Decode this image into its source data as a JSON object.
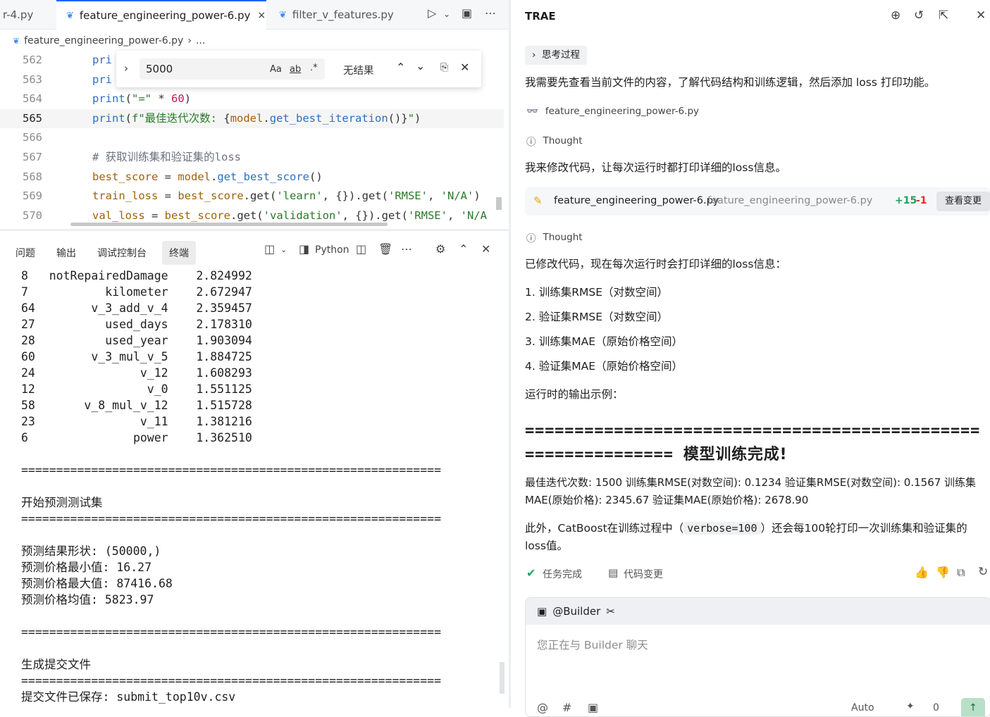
{
  "tabs": [
    {
      "label": "r-4.py"
    },
    {
      "label": "feature_engineering_power-6.py",
      "close": "×"
    },
    {
      "label": "filter_v_features.py"
    }
  ],
  "breadcrumb": {
    "file": "feature_engineering_power-6.py",
    "sep": "›",
    "more": "..."
  },
  "find": {
    "value": "5000",
    "case_label": "Aa",
    "word_label": "ab",
    "regex_label": ".*",
    "result": "无结果"
  },
  "code_lines": [
    {
      "n": "562",
      "parts": [
        [
          "kw",
          "pri"
        ]
      ]
    },
    {
      "n": "563",
      "parts": [
        [
          "kw",
          "pri"
        ]
      ]
    },
    {
      "n": "564",
      "parts": [
        [
          "kw",
          "print"
        ],
        [
          "op",
          "("
        ],
        [
          "str",
          "\"=\""
        ],
        [
          "op",
          " * "
        ],
        [
          "num",
          "60"
        ],
        [
          "op",
          ")"
        ]
      ]
    },
    {
      "n": "565",
      "parts": [
        [
          "kw",
          "print"
        ],
        [
          "op",
          "("
        ],
        [
          "str",
          "f\"最佳迭代次数: "
        ],
        [
          "op",
          "{"
        ],
        [
          "var",
          "model"
        ],
        [
          "op",
          "."
        ],
        [
          "kw",
          "get_best_iteration"
        ],
        [
          "op",
          "()}"
        ],
        [
          "str",
          "\""
        ],
        [
          "op",
          ")"
        ]
      ]
    },
    {
      "n": "566",
      "parts": []
    },
    {
      "n": "567",
      "parts": [
        [
          "cm",
          "# 获取训练集和验证集的loss"
        ]
      ]
    },
    {
      "n": "568",
      "parts": [
        [
          "var",
          "best_score"
        ],
        [
          "op",
          " = "
        ],
        [
          "var",
          "model"
        ],
        [
          "op",
          "."
        ],
        [
          "kw",
          "get_best_score"
        ],
        [
          "op",
          "()"
        ]
      ]
    },
    {
      "n": "569",
      "parts": [
        [
          "var",
          "train_loss"
        ],
        [
          "op",
          " = "
        ],
        [
          "var",
          "best_score"
        ],
        [
          "op",
          ".get("
        ],
        [
          "str",
          "'learn'"
        ],
        [
          "op",
          ", {}).get("
        ],
        [
          "str",
          "'RMSE'"
        ],
        [
          "op",
          ", "
        ],
        [
          "str",
          "'N/A'"
        ],
        [
          "op",
          ")"
        ]
      ]
    },
    {
      "n": "570",
      "parts": [
        [
          "var",
          "val_loss"
        ],
        [
          "op",
          " = "
        ],
        [
          "var",
          "best_score"
        ],
        [
          "op",
          ".get("
        ],
        [
          "str",
          "'validation'"
        ],
        [
          "op",
          ", {}).get("
        ],
        [
          "str",
          "'RMSE'"
        ],
        [
          "op",
          ", "
        ],
        [
          "str",
          "'N/A"
        ]
      ]
    }
  ],
  "panel": {
    "tabs": [
      "问题",
      "输出",
      "调试控制台",
      "终端"
    ],
    "python_label": "Python"
  },
  "terminal_lines": [
    "8   notRepairedDamage    2.824992",
    "7           kilometer    2.672947",
    "64        v_3_add_v_4    2.359457",
    "27          used_days    2.178310",
    "28          used_year    1.903094",
    "60        v_3_mul_v_5    1.884725",
    "24               v_12    1.608293",
    "12                v_0    1.551125",
    "58       v_8_mul_v_12    1.515728",
    "23               v_11    1.381216",
    "6               power    1.362510",
    "",
    "============================================================",
    "",
    "开始预测测试集",
    "============================================================",
    "",
    "预测结果形状: (50000,)",
    "预测价格最小值: 16.27",
    "预测价格最大值: 87416.68",
    "预测价格均值: 5823.97",
    "",
    "============================================================",
    "",
    "生成提交文件",
    "============================================================",
    "提交文件已保存: submit_top10v.csv"
  ],
  "right": {
    "title": "TRAE",
    "thinking_label": "思考过程",
    "p1": "我需要先查看当前文件的内容，了解代码结构和训练逻辑，然后添加 loss 打印功能。",
    "viewed_file": "feature_engineering_power-6.py",
    "thought": "Thought",
    "p2": "我来修改代码，让每次运行时都打印详细的loss信息。",
    "card": {
      "file": "feature_engineering_power-6.py",
      "path": "feature_engineering_power-6.py",
      "add": "+15",
      "del": "-1",
      "button": "查看变更"
    },
    "p3": "已修改代码，现在每次运行时会打印详细的loss信息：",
    "list": [
      "1. 训练集RMSE（对数空间）",
      "2. 验证集RMSE（对数空间）",
      "3. 训练集MAE（原始价格空间）",
      "4. 验证集MAE（原始价格空间）"
    ],
    "p4": "运行时的输出示例：",
    "ruler_eq": "=============================================================",
    "ruler_title": "模型训练完成!",
    "p5": "最佳迭代次数: 1500 训练集RMSE(对数空间): 0.1234 验证集RMSE(对数空间): 0.1567 训练集MAE(原始价格): 2345.67 验证集MAE(原始价格): 2678.90",
    "p6a": "此外，CatBoost在训练过程中（",
    "p6code": "verbose=100",
    "p6b": "）还会每100轮打印一次训练集和验证集的loss值。",
    "task_done": "任务完成",
    "code_change": "代码变更",
    "builder": "@Builder",
    "placeholder": "您正在与 Builder 聊天",
    "auto": "Auto",
    "zero": "0"
  },
  "colors": {
    "accent": "#1e66f5",
    "success": "#22a060",
    "add": "#22a060",
    "del": "#d93025"
  }
}
